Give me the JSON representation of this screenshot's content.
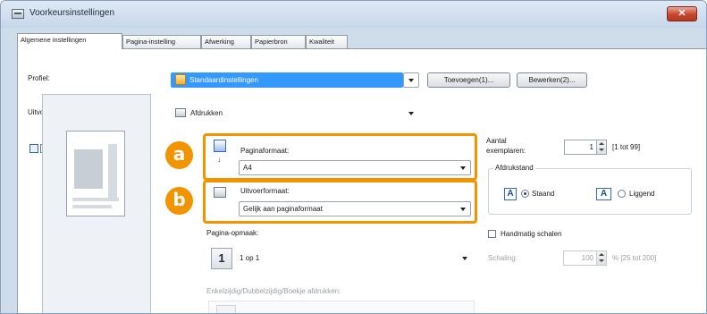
{
  "window": {
    "title": "Voorkeursinstellingen",
    "close_glyph": "✕"
  },
  "tabs": [
    {
      "label": "Algemene instellingen"
    },
    {
      "label": "Pagina-instelling"
    },
    {
      "label": "Afwerking"
    },
    {
      "label": "Papierbron"
    },
    {
      "label": "Kwaliteit"
    }
  ],
  "profile": {
    "label": "Profiel:",
    "value": "Standaardinstellingen",
    "add_button": "Toevoegen(1)...",
    "edit_button": "Bewerken(2)..."
  },
  "output_mode": {
    "label": "Uitvoermodus:",
    "value": "Afdrukken"
  },
  "page_size": {
    "label": "Paginaformaat:",
    "value": "A4"
  },
  "output_size": {
    "label": "Uitvoerformaat:",
    "value": "Gelijk aan paginaformaat"
  },
  "page_layout": {
    "label": "Pagina-opmaak:",
    "value": "1 op 1",
    "number_glyph": "1"
  },
  "duplex": {
    "label": "Enkelzijdig/Dubbelzijdig/Boekje afdrukken:"
  },
  "copies": {
    "label_line1": "Aantal",
    "label_line2": "exemplaren:",
    "value": "1",
    "range": "[1 tot 99]"
  },
  "orientation": {
    "group_label": "Afdrukstand",
    "portrait": "Staand",
    "landscape": "Liggend",
    "selected": "Staand",
    "icon_letter": "A"
  },
  "manual_scaling": {
    "checkbox_label": "Handmatig schalen",
    "checked": false,
    "scale_label": "Schaling:",
    "scale_value": "100",
    "scale_unit": "% [25 tot 200]"
  },
  "callouts": {
    "a": "a",
    "b": "b"
  },
  "colors": {
    "accent_orange": "#f29400",
    "selection_blue": "#3399ff"
  }
}
